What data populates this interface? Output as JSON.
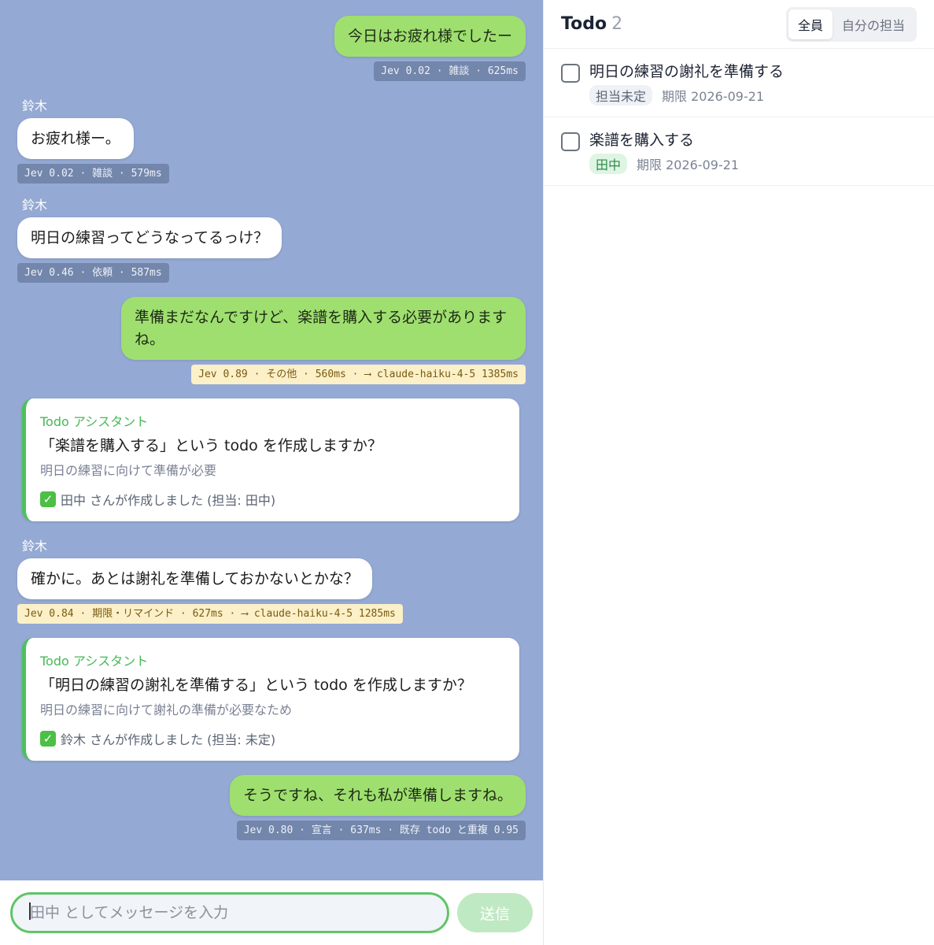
{
  "chat": {
    "messages": [
      {
        "kind": "mine",
        "text": "今日はお疲れ様でしたー",
        "meta": "Jev 0.02 · 雑談 · 625ms",
        "warn": false
      },
      {
        "kind": "other",
        "sender": "鈴木",
        "text": "お疲れ様ー。",
        "meta": "Jev 0.02 · 雑談 · 579ms",
        "warn": false
      },
      {
        "kind": "other",
        "sender": "鈴木",
        "text": "明日の練習ってどうなってるっけ？",
        "meta": "Jev 0.46 · 依頼 · 587ms",
        "warn": false
      },
      {
        "kind": "mine",
        "text": "準備まだなんですけど、楽譜を購入する必要がありますね。",
        "meta": "Jev 0.89 · その他 · 560ms · ⟶ claude-haiku-4-5 1385ms",
        "warn": true
      },
      {
        "kind": "assistant",
        "title": "Todo アシスタント",
        "question": "「楽譜を購入する」という todo を作成しますか？",
        "reason": "明日の練習に向けて準備が必要",
        "done": "田中 さんが作成しました (担当: 田中)"
      },
      {
        "kind": "other",
        "sender": "鈴木",
        "text": "確かに。あとは謝礼を準備しておかないとかな？",
        "meta": "Jev 0.84 · 期限・リマインド · 627ms · ⟶ claude-haiku-4-5 1285ms",
        "warn": true
      },
      {
        "kind": "assistant",
        "title": "Todo アシスタント",
        "question": "「明日の練習の謝礼を準備する」という todo を作成しますか？",
        "reason": "明日の練習に向けて謝礼の準備が必要なため",
        "done": "鈴木 さんが作成しました (担当: 未定)"
      },
      {
        "kind": "mine",
        "text": "そうですね、それも私が準備しますね。",
        "meta": "Jev 0.80 · 宣言 · 637ms · 既存 todo と重複 0.95",
        "warn": false
      }
    ],
    "composer_placeholder": "田中 としてメッセージを入力",
    "send_label": "送信"
  },
  "todo": {
    "title": "Todo",
    "count": "2",
    "filters": [
      "全員",
      "自分の担当"
    ],
    "active_filter": "全員",
    "items": [
      {
        "text": "明日の練習の謝礼を準備する",
        "assignee": "担当未定",
        "assignee_kind": "none",
        "due": "期限 2026-09-21"
      },
      {
        "text": "楽譜を購入する",
        "assignee": "田中",
        "assignee_kind": "user",
        "due": "期限 2026-09-21"
      }
    ]
  },
  "colors": {
    "chat_bg": "#94a9d3",
    "mine_bubble": "#9fdf6f",
    "accent_green": "#4cc15c",
    "meta_warn_bg": "#fbf0c8"
  }
}
